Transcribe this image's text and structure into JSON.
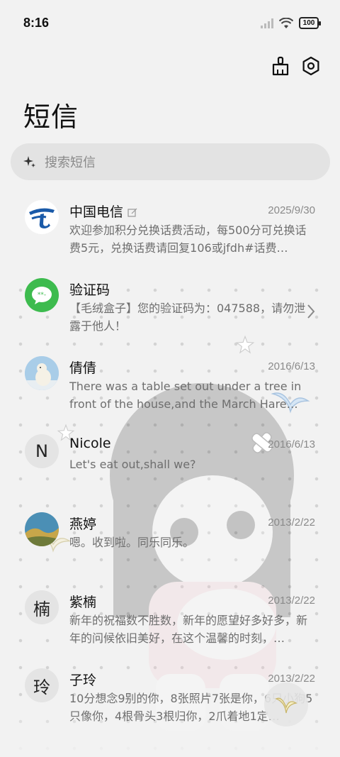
{
  "status_bar": {
    "time": "8:16",
    "battery": "100"
  },
  "header": {
    "title": "短信"
  },
  "search": {
    "placeholder": "搜索短信"
  },
  "messages": [
    {
      "name": "中国电信",
      "date": "2025/9/30",
      "preview": "欢迎参加积分兑换话费活动，每500分可兑换话费5元，兑换话费请回复106或jfdh#话费…",
      "avatar": "china-telecom-logo"
    },
    {
      "name": "验证码",
      "date": "",
      "preview": "【毛绒盒子】您的验证码为：047588，请勿泄露于他人！",
      "avatar": "sms-code-icon"
    },
    {
      "name": "倩倩",
      "date": "2016/6/13",
      "preview": "There was a table set out under a tree in front of the house,and the March Hare an…",
      "avatar": "polar-bear-photo"
    },
    {
      "name": "Nicole",
      "date": "2016/6/13",
      "preview": "Let's eat out,shall we?",
      "avatar_letter": "N"
    },
    {
      "name": "燕婷",
      "date": "2013/2/22",
      "preview": "嗯。收到啦。同乐同乐。",
      "avatar": "landscape-photo"
    },
    {
      "name": "紫楠",
      "date": "2013/2/22",
      "preview": "新年的祝福数不胜数，新年的愿望好多好多，新年的问候依旧美好，在这个温馨的时刻，…",
      "avatar_letter": "楠"
    },
    {
      "name": "子玲",
      "date": "2013/2/22",
      "preview": "10分想念9别的你，8张照片7张是你，6只小狗5只像你，4根骨头3根归你，2爪着地1定…",
      "avatar_letter": "玲"
    }
  ],
  "colors": {
    "telecom_blue": "#1a5aa8",
    "sms_green": "#3dbb4e",
    "background": "#f2f2f2"
  }
}
